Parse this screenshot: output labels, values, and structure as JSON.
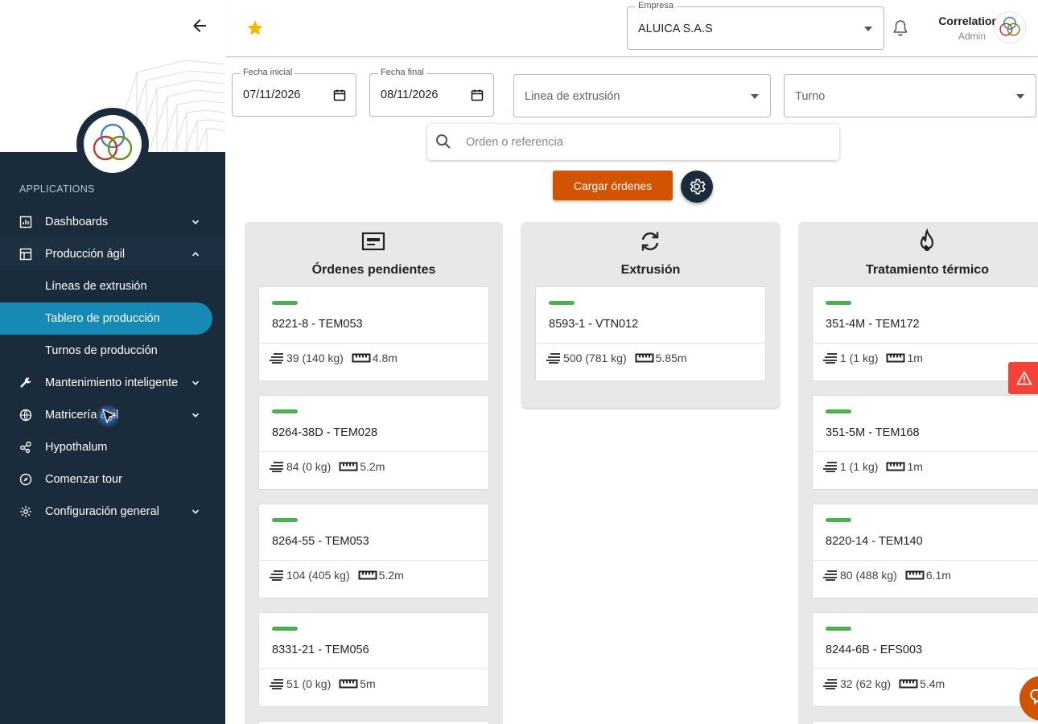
{
  "sidebar": {
    "applications_title": "APPLICATIONS",
    "items": [
      {
        "label": "Dashboards"
      },
      {
        "label": "Producción ágil"
      },
      {
        "label": "Líneas de extrusión"
      },
      {
        "label": "Tablero de producción"
      },
      {
        "label": "Turnos de producción"
      },
      {
        "label": "Mantenimiento inteligente"
      },
      {
        "label": "Matricería ágil"
      },
      {
        "label": "Hypothalum"
      },
      {
        "label": "Comenzar tour"
      },
      {
        "label": "Configuración general"
      }
    ]
  },
  "header": {
    "company_label": "Empresa",
    "company_value": "ALUICA S.A.S",
    "user_name": "Correlation",
    "user_role": "Admin"
  },
  "filters": {
    "start_label": "Fecha inicial",
    "start_value": "07/11/2026",
    "end_label": "Fecha final",
    "end_value": "08/11/2026",
    "line_placeholder": "Linea de extrusión",
    "shift_placeholder": "Turno",
    "search_placeholder": "Orden o referencia",
    "load_button": "Cargar órdenes"
  },
  "columns": [
    {
      "title": "Órdenes pendientes",
      "icon": "document-icon",
      "cards": [
        {
          "title": "8221-8 - TEM053",
          "qty": "39 (140 kg)",
          "length": "4.8m"
        },
        {
          "title": "8264-38D - TEM028",
          "qty": "84 (0 kg)",
          "length": "5.2m"
        },
        {
          "title": "8264-55 - TEM053",
          "qty": "104 (405 kg)",
          "length": "5.2m"
        },
        {
          "title": "8331-21 - TEM056",
          "qty": "51 (0 kg)",
          "length": "5m"
        }
      ]
    },
    {
      "title": "Extrusión",
      "icon": "sync-icon",
      "cards": [
        {
          "title": "8593-1 - VTN012",
          "qty": "500 (781 kg)",
          "length": "5.85m"
        }
      ]
    },
    {
      "title": "Tratamiento térmico",
      "icon": "fire-icon",
      "cards": [
        {
          "title": "351-4M - TEM172",
          "qty": "1 (1 kg)",
          "length": "1m"
        },
        {
          "title": "351-5M - TEM168",
          "qty": "1 (1 kg)",
          "length": "1m"
        },
        {
          "title": "8220-14 - TEM140",
          "qty": "80 (488 kg)",
          "length": "6.1m"
        },
        {
          "title": "8244-6B - EFS003",
          "qty": "32 (62 kg)",
          "length": "5.4m"
        }
      ]
    }
  ],
  "colors": {
    "sidebar_bg": "#1a2b3c",
    "active_item": "#1789b5",
    "primary_button": "#d35400",
    "status_bar": "#4caf50",
    "alert": "#f44336",
    "star": "#f5b800"
  }
}
